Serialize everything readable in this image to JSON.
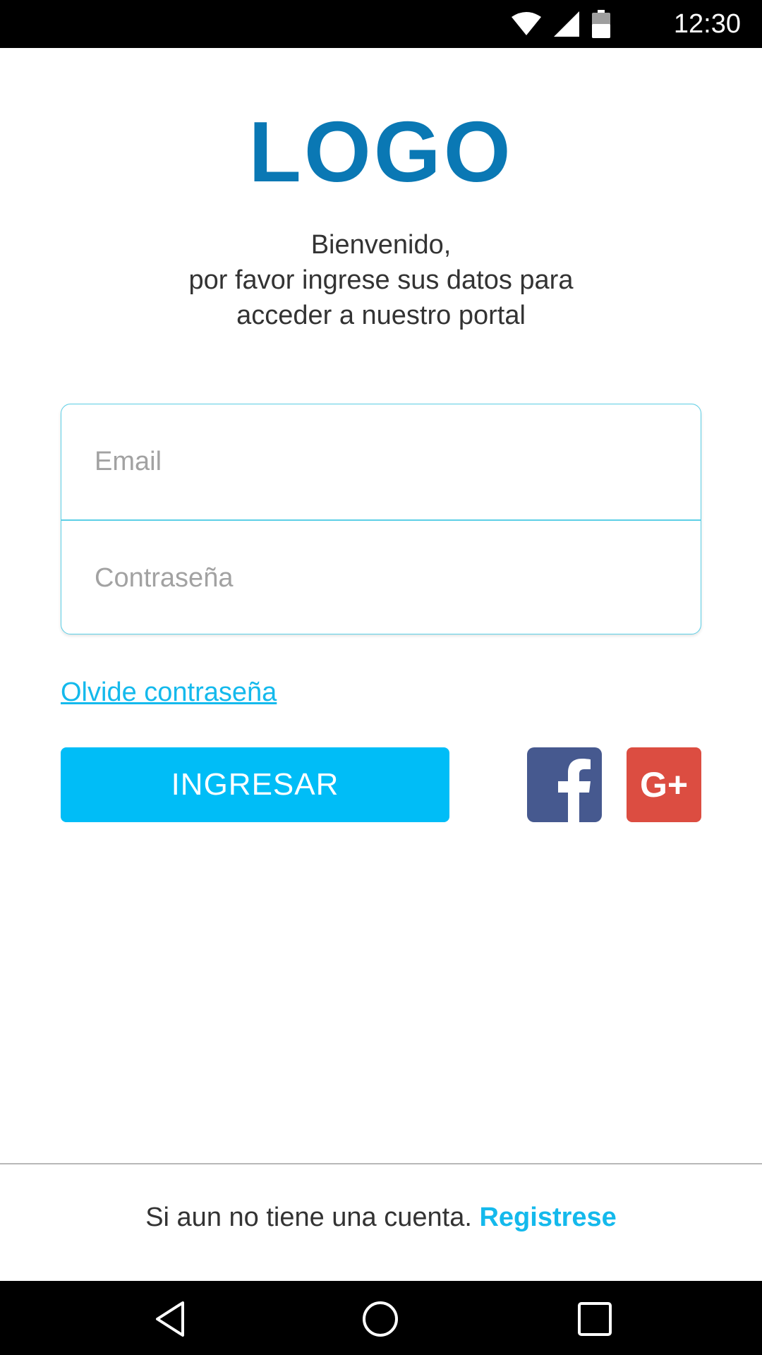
{
  "status_bar": {
    "time": "12:30",
    "icons": [
      "wifi-icon",
      "signal-icon",
      "battery-icon"
    ]
  },
  "header": {
    "logo_text": "LOGO",
    "welcome_line1": "Bienvenido,",
    "welcome_line2": "por favor ingrese sus datos para",
    "welcome_line3": "acceder a nuestro portal"
  },
  "form": {
    "email_placeholder": "Email",
    "email_value": "",
    "password_placeholder": "Contraseña",
    "password_value": "",
    "forgot_label": "Olvide contraseña",
    "login_label": "INGRESAR"
  },
  "social": {
    "facebook_icon": "facebook-icon",
    "google_plus_label": "G+"
  },
  "footer": {
    "signup_text": "Si aun no tiene una cuenta.",
    "signup_link": "Registrese"
  },
  "nav_bar": {
    "icons": [
      "back-icon",
      "home-icon",
      "recents-icon"
    ]
  },
  "colors": {
    "logo": "#0a78b4",
    "accent": "#00bdf7",
    "link": "#14b9ec",
    "field_border": "#5ccfe6",
    "facebook": "#46598f",
    "google_plus": "#dc4d41"
  }
}
